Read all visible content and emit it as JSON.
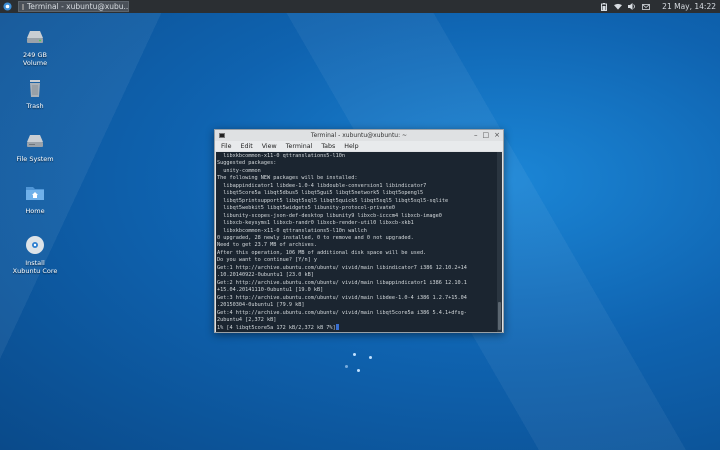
{
  "panel": {
    "task_title": "Terminal - xubuntu@xubu...",
    "clock": "21 May, 14:22"
  },
  "desktop": {
    "icons": [
      {
        "label": "249 GB Volume"
      },
      {
        "label": "Trash"
      },
      {
        "label": "File System"
      },
      {
        "label": "Home"
      },
      {
        "label": "Install\nXubuntu Core"
      }
    ]
  },
  "terminal": {
    "title": "Terminal - xubuntu@xubuntu: ~",
    "menu": [
      "File",
      "Edit",
      "View",
      "Terminal",
      "Tabs",
      "Help"
    ],
    "lines": [
      "  libxkbcommon-x11-0 qttranslations5-l10n",
      "Suggested packages:",
      "  unity-common",
      "The following NEW packages will be installed:",
      "  libappindicator1 libdee-1.0-4 libdouble-conversion1 libindicator7",
      "  libqt5core5a libqt5dbus5 libqt5gui5 libqt5network5 libqt5opengl5",
      "  libqt5printsupport5 libqt5sql5 libqt5quick5 libqt5sql5 libqt5sql5-sqlite",
      "  libqt5webkit5 libqt5widgets5 libunity-protocol-private0",
      "  libunity-scopes-json-def-desktop libunity9 libxcb-icccm4 libxcb-image0",
      "  libxcb-keysyms1 libxcb-randr0 libxcb-render-util0 libxcb-xkb1",
      "  libxkbcommon-x11-0 qttranslations5-l10n wallch",
      "0 upgraded, 28 newly installed, 0 to remove and 0 not upgraded.",
      "Need to get 23.7 MB of archives.",
      "After this operation, 106 MB of additional disk space will be used.",
      "Do you want to continue? [Y/n] y",
      "Get:1 http://archive.ubuntu.com/ubuntu/ vivid/main libindicator7 i386 12.10.2+14",
      ".10.20140922-0ubuntu1 [23.0 kB]",
      "Get:2 http://archive.ubuntu.com/ubuntu/ vivid/main libappindicator1 i386 12.10.1",
      "+15.04.20141110-0ubuntu1 [19.0 kB]",
      "Get:3 http://archive.ubuntu.com/ubuntu/ vivid/main libdee-1.0-4 i386 1.2.7+15.04",
      ".20150304-0ubuntu1 [79.9 kB]",
      "Get:4 http://archive.ubuntu.com/ubuntu/ vivid/main libqt5core5a i386 5.4.1+dfsg-",
      "2ubuntu4 [2,372 kB]"
    ],
    "prompt_line": "1% [4 libqt5core5a 172 kB/2,372 kB 7%]"
  },
  "colors": {
    "accent": "#0f63b0",
    "terminal_bg": "#1b2530",
    "panel_bg": "#2b2f33"
  }
}
